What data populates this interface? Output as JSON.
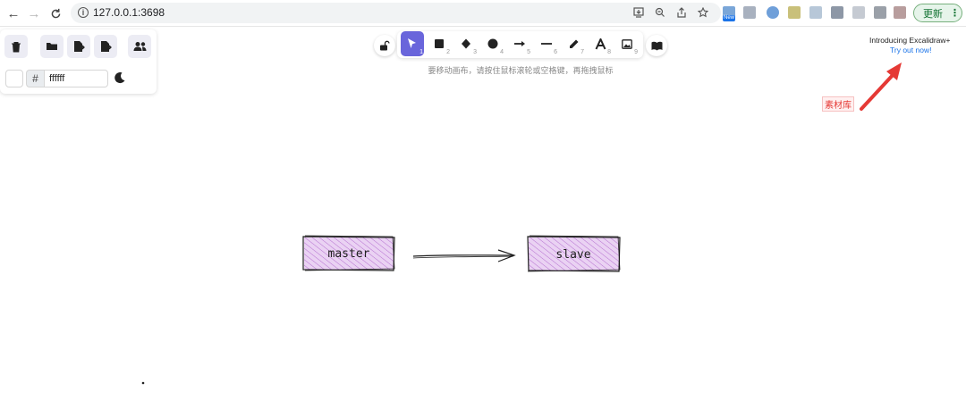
{
  "browser": {
    "url": "127.0.0.1:3698",
    "update_label": "更新",
    "new_badge": "New",
    "icons": [
      "back-arrow",
      "forward-arrow",
      "reload",
      "info",
      "install-app",
      "zoom",
      "share",
      "bookmark-star",
      "kebab-menu"
    ]
  },
  "side_panel": {
    "buttons": [
      "trash-icon",
      "open-folder-icon",
      "export-file-icon",
      "export-image-icon",
      "collaborators-icon"
    ],
    "background_hex": "ffffff",
    "hash": "#",
    "theme_icon": "moon-icon"
  },
  "toolbar": {
    "tools": [
      {
        "name": "selection",
        "num": "1",
        "active": true
      },
      {
        "name": "rectangle",
        "num": "2"
      },
      {
        "name": "diamond",
        "num": "3"
      },
      {
        "name": "ellipse",
        "num": "4"
      },
      {
        "name": "arrow",
        "num": "5"
      },
      {
        "name": "line",
        "num": "6"
      },
      {
        "name": "pencil",
        "num": "7"
      },
      {
        "name": "text",
        "num": "8"
      },
      {
        "name": "image",
        "num": "9"
      }
    ],
    "hint": "要移动画布，请按住鼠标滚轮或空格键，再拖拽鼠标",
    "accent": "#6965db"
  },
  "promo": {
    "title": "Introducing Excalidraw+",
    "link": "Try out now!"
  },
  "library_label": "素材库",
  "diagram": {
    "nodes": [
      {
        "id": "master",
        "label": "master"
      },
      {
        "id": "slave",
        "label": "slave"
      }
    ],
    "fill": "#d7a8e8",
    "stroke": "#1e1e1e"
  }
}
